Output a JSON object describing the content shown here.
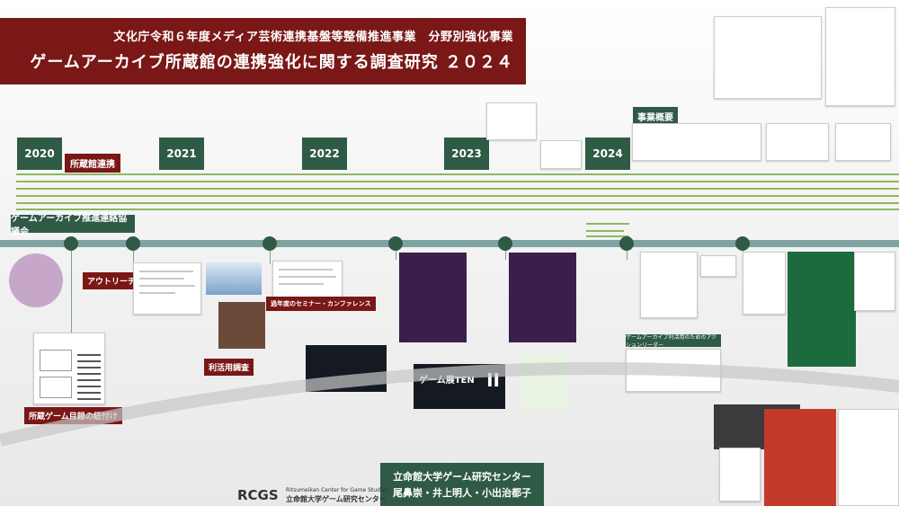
{
  "banner": {
    "subtitle": "文化庁令和６年度メディア芸術連携基盤等整備推進事業　分野別強化事業",
    "title": "ゲームアーカイブ所蔵館の連携強化に関する調査研究 ２０２４"
  },
  "years": [
    "2020",
    "2021",
    "2022",
    "2023",
    "2024"
  ],
  "tags": {
    "museum_link": "所蔵館連携",
    "council": "ゲームアーカイブ推進連絡協議会",
    "outreach": "アウトリーチ",
    "seminar": "過年度のセミナー・カンファレンス",
    "usage_survey": "利活用調査",
    "catalog_link": "所蔵ゲーム目録の紐付け",
    "project_overview": "事業概要",
    "action_plan": "ゲームアーカイブ利活用のためのアクションリーダー"
  },
  "posters": {
    "gametens_title": "ゲーム展TEN",
    "gametens_num": "II"
  },
  "footer": {
    "org": "立命館大学ゲーム研究センター",
    "authors": "尾鼻崇・井上明人・小出治都子",
    "logo_mark": "RCGS",
    "logo_en": "Ritsumeikan Center for Game Studies",
    "logo_ja": "立命館大学ゲーム研究センター"
  },
  "colors": {
    "banner": "#7a1717",
    "year_box": "#2f5a46",
    "timeline": "#7fa3a0",
    "lanes": "#8db860"
  }
}
